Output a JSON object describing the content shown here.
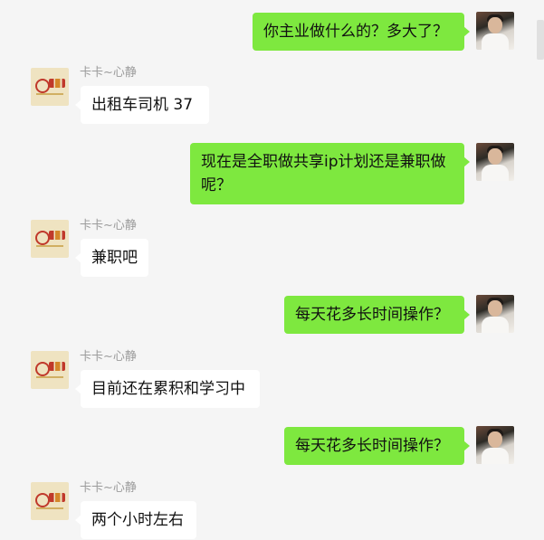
{
  "colors": {
    "background": "#f5f5f5",
    "my_bubble": "#7ee83f",
    "other_bubble": "#ffffff",
    "name_text": "#9b9b9b"
  },
  "contact": {
    "name": "卡卡~心静"
  },
  "messages": [
    {
      "sender": "me",
      "text": "你主业做什么的？多大了？"
    },
    {
      "sender": "other",
      "name": "卡卡~心静",
      "text": "出租车司机  37"
    },
    {
      "sender": "me",
      "text": "现在是全职做共享ip计划还是兼职做呢？"
    },
    {
      "sender": "other",
      "name": "卡卡~心静",
      "text": "兼职吧"
    },
    {
      "sender": "me",
      "text": "每天花多长时间操作？"
    },
    {
      "sender": "other",
      "name": "卡卡~心静",
      "text": "目前还在累积和学习中"
    },
    {
      "sender": "me",
      "text": "每天花多长时间操作？"
    },
    {
      "sender": "other",
      "name": "卡卡~心静",
      "text": "两个小时左右"
    }
  ]
}
